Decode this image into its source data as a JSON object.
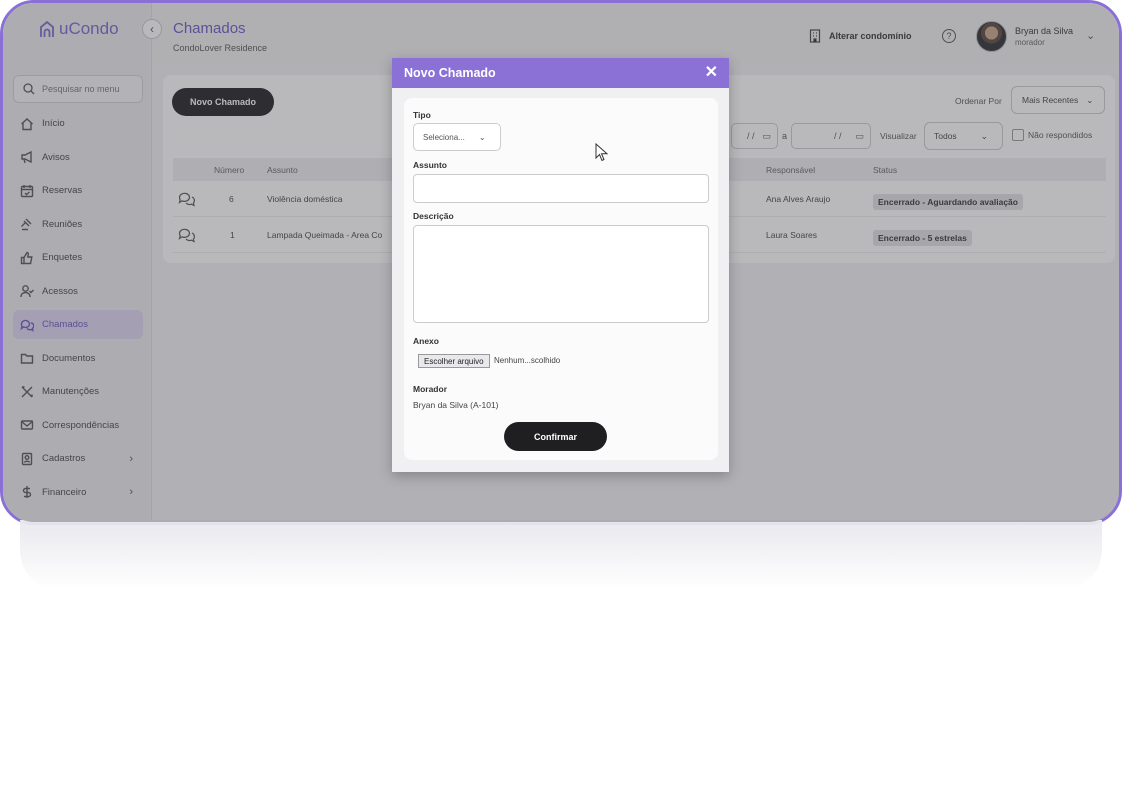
{
  "app": {
    "logo_text": "uCondo",
    "search_placeholder": "Pesquisar no menu",
    "accent_color": "#8b71d6"
  },
  "sidebar": {
    "items": [
      {
        "label": "Início",
        "icon": "home-icon"
      },
      {
        "label": "Avisos",
        "icon": "megaphone-icon"
      },
      {
        "label": "Reservas",
        "icon": "calendar-icon"
      },
      {
        "label": "Reuniões",
        "icon": "gavel-icon"
      },
      {
        "label": "Enquetes",
        "icon": "thumbs-up-icon"
      },
      {
        "label": "Acessos",
        "icon": "user-check-icon"
      },
      {
        "label": "Chamados",
        "icon": "chat-icon",
        "active": true
      },
      {
        "label": "Documentos",
        "icon": "folder-icon"
      },
      {
        "label": "Manutenções",
        "icon": "tools-icon"
      },
      {
        "label": "Correspondências",
        "icon": "mail-icon"
      },
      {
        "label": "Cadastros",
        "icon": "id-card-icon",
        "has_submenu": true
      },
      {
        "label": "Financeiro",
        "icon": "dollar-icon",
        "has_submenu": true
      }
    ]
  },
  "header": {
    "title": "Chamados",
    "subtitle": "CondoLover Residence",
    "alterar_label": "Alterar condomínio",
    "user_name": "Bryan da Silva",
    "user_role": "morador"
  },
  "main": {
    "new_button": "Novo Chamado",
    "ordenar_label": "Ordenar Por",
    "ordenar_value": "Mais Recentes",
    "date_placeholder": "/ /",
    "date_sep": "a",
    "visualizar_label": "Visualizar",
    "visualizar_value": "Todos",
    "nao_respondidos": "Não respondidos",
    "columns": {
      "numero": "Número",
      "assunto": "Assunto",
      "responsavel": "Responsável",
      "status": "Status"
    },
    "rows": [
      {
        "numero": "6",
        "assunto": "Violência doméstica",
        "responsavel": "Ana Alves Araujo",
        "status": "Encerrado - Aguardando avaliação"
      },
      {
        "numero": "1",
        "assunto": "Lampada Queimada - Area Co",
        "responsavel": "Laura Soares",
        "status": "Encerrado - 5 estrelas"
      }
    ]
  },
  "modal": {
    "title": "Novo Chamado",
    "tipo_label": "Tipo",
    "tipo_value": "Seleciona...",
    "assunto_label": "Assunto",
    "descricao_label": "Descrição",
    "anexo_label": "Anexo",
    "file_button": "Escolher arquivo",
    "file_name": "Nenhum...scolhido",
    "morador_label": "Morador",
    "morador_value": "Bryan da Silva (A-101)",
    "confirm_label": "Confirmar"
  }
}
